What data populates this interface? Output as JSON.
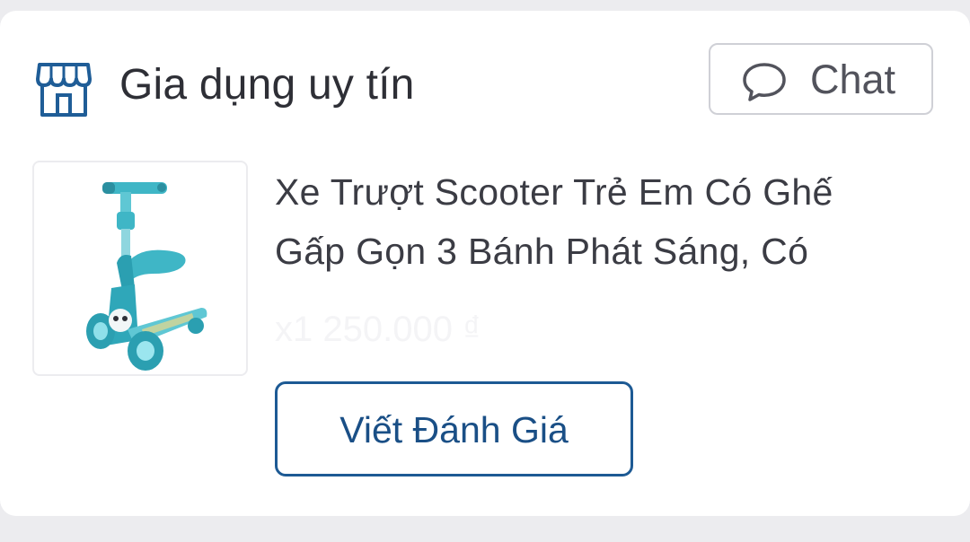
{
  "shop": {
    "icon": "storefront-icon",
    "name": "Gia dụng uy tín",
    "chat_icon": "chat-bubble-icon",
    "chat_label": "Chat"
  },
  "product": {
    "thumbnail": "scooter-product-image",
    "title_lines": [
      "Xe Trượt Scooter Trẻ Em Có Ghế",
      "Gấp Gọn 3 Bánh Phát Sáng, Có"
    ],
    "price": "x1  250.000 ₫"
  },
  "actions": {
    "review_label": "Viết Đánh Giá"
  },
  "colors": {
    "accent": "#1d5a94",
    "shop_icon": "#1f5d97",
    "scooter": "#3fb6c6"
  }
}
